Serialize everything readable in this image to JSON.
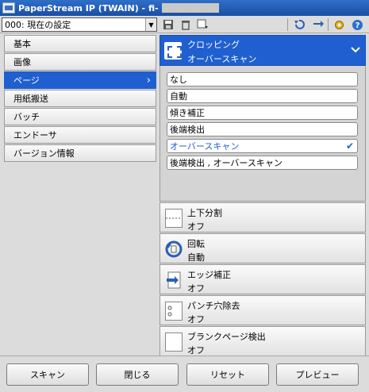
{
  "window": {
    "title": "PaperStream IP (TWAIN) - fi-"
  },
  "toolbar": {
    "profile_value": "000: 現在の設定",
    "icons": [
      "save-icon",
      "delete-icon",
      "profile-manage-icon",
      "undo-icon",
      "switch-icon",
      "settings-icon",
      "help-icon"
    ]
  },
  "nav": {
    "items": [
      {
        "label": "基本"
      },
      {
        "label": "画像"
      },
      {
        "label": "ページ"
      },
      {
        "label": "用紙搬送"
      },
      {
        "label": "バッチ"
      },
      {
        "label": "エンドーサ"
      },
      {
        "label": "バージョン情報"
      }
    ],
    "active_index": 2
  },
  "cropping": {
    "title": "クロッピング",
    "value": "オーバースキャン",
    "options": [
      {
        "label": "なし"
      },
      {
        "label": "自動"
      },
      {
        "label": "傾き補正"
      },
      {
        "label": "後端検出"
      },
      {
        "label": "オーバースキャン"
      },
      {
        "label": "後端検出 , オーバースキャン"
      }
    ],
    "selected_index": 4
  },
  "settings": [
    {
      "name": "上下分割",
      "value": "オフ"
    },
    {
      "name": "回転",
      "value": "自動"
    },
    {
      "name": "エッジ補正",
      "value": "オフ"
    },
    {
      "name": "パンチ穴除去",
      "value": "オフ"
    },
    {
      "name": "ブランクページ検出",
      "value": "オフ"
    }
  ],
  "buttons": {
    "scan": "スキャン",
    "close": "閉じる",
    "reset": "リセット",
    "preview": "プレビュー"
  },
  "colors": {
    "accent": "#1f5fd0",
    "titlebar": "#2f6fc9"
  }
}
